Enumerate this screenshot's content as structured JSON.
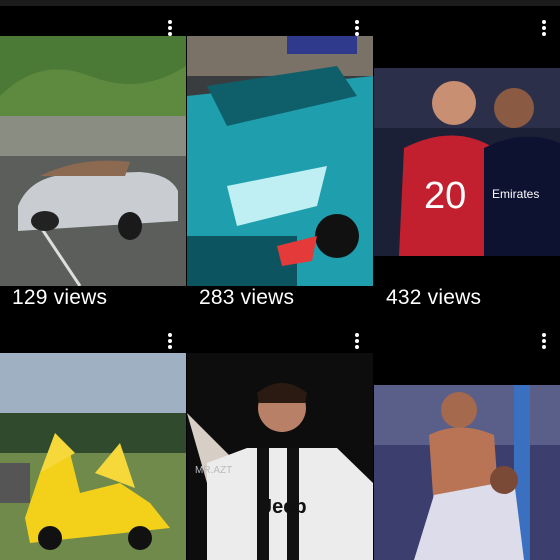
{
  "videos": [
    {
      "id": "v1",
      "views": "129 views",
      "subject": "silver convertible sports car"
    },
    {
      "id": "v2",
      "views": "283 views",
      "subject": "teal supercar"
    },
    {
      "id": "v3",
      "views": "432 views",
      "subject": "two footballers face off"
    },
    {
      "id": "v4",
      "views": "",
      "subject": "yellow hypercar with doors open"
    },
    {
      "id": "v5",
      "views": "",
      "subject": "footballer celebrating"
    },
    {
      "id": "v6",
      "views": "",
      "subject": "footballer celebrating shirtless"
    }
  ],
  "labels": {
    "jersey_number": "20",
    "jersey_sponsor": "Jeep",
    "jersey_sponsor_2": "Emirates",
    "watermark": "MR.AZT"
  },
  "icons": {
    "more": "more-vertical-icon"
  }
}
